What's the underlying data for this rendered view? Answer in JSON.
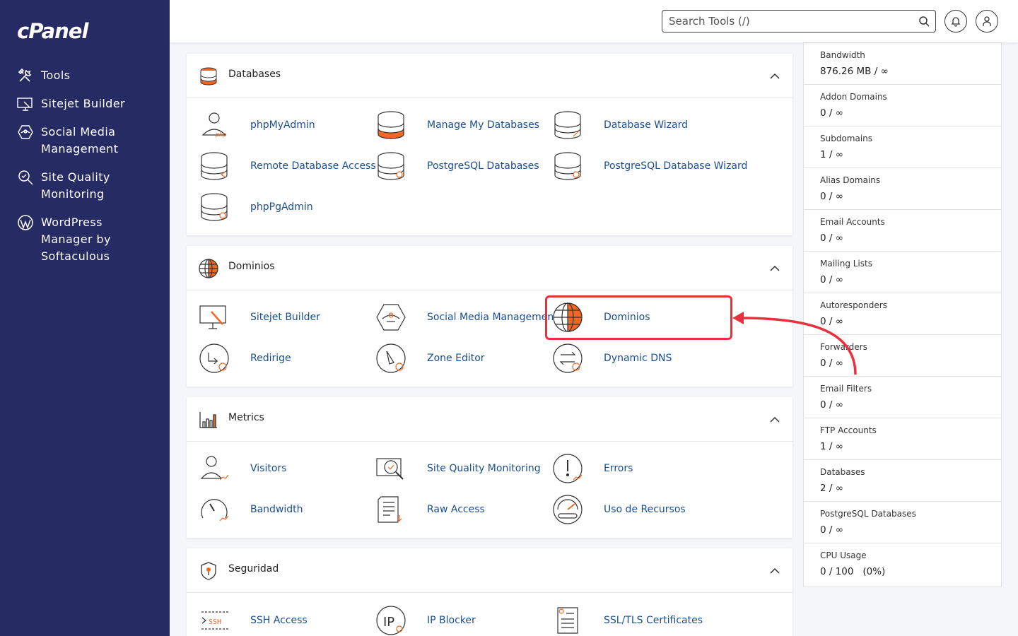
{
  "brand": {
    "logo": "cPanel"
  },
  "sidebar": {
    "items": [
      {
        "label": "Tools",
        "icon": "tools-icon"
      },
      {
        "label": "Sitejet Builder",
        "icon": "sitejet-icon"
      },
      {
        "label": "Social Media Management",
        "icon": "social-media-icon"
      },
      {
        "label": "Site Quality Monitoring",
        "icon": "site-quality-icon"
      },
      {
        "label": "WordPress Manager by Softaculous",
        "icon": "wordpress-icon"
      }
    ]
  },
  "header": {
    "search_placeholder": "Search Tools (/)",
    "search_icon": "search-icon",
    "notifications_icon": "bell-icon",
    "user_icon": "user-icon"
  },
  "sections": [
    {
      "title": "Databases",
      "icon": "database-icon",
      "tools": [
        {
          "label": "phpMyAdmin",
          "icon": "phpmyadmin-icon"
        },
        {
          "label": "Manage My Databases",
          "icon": "manage-databases-icon"
        },
        {
          "label": "Database Wizard",
          "icon": "database-wizard-icon"
        },
        {
          "label": "Remote Database Access",
          "icon": "remote-database-icon"
        },
        {
          "label": "PostgreSQL Databases",
          "icon": "postgresql-icon"
        },
        {
          "label": "PostgreSQL Database Wizard",
          "icon": "postgresql-wizard-icon"
        },
        {
          "label": "phpPgAdmin",
          "icon": "phppgadmin-icon"
        }
      ]
    },
    {
      "title": "Dominios",
      "icon": "globe-icon",
      "tools": [
        {
          "label": "Sitejet Builder",
          "icon": "sitejet-icon"
        },
        {
          "label": "Social Media Management",
          "icon": "social-media-icon"
        },
        {
          "label": "Dominios",
          "icon": "globe-icon"
        },
        {
          "label": "Redirige",
          "icon": "redirect-icon"
        },
        {
          "label": "Zone Editor",
          "icon": "zone-editor-icon"
        },
        {
          "label": "Dynamic DNS",
          "icon": "dynamic-dns-icon"
        }
      ]
    },
    {
      "title": "Metrics",
      "icon": "metrics-icon",
      "tools": [
        {
          "label": "Visitors",
          "icon": "visitors-icon"
        },
        {
          "label": "Site Quality Monitoring",
          "icon": "site-quality-icon"
        },
        {
          "label": "Errors",
          "icon": "errors-icon"
        },
        {
          "label": "Bandwidth",
          "icon": "bandwidth-icon"
        },
        {
          "label": "Raw Access",
          "icon": "raw-access-icon"
        },
        {
          "label": "Uso de Recursos",
          "icon": "resource-usage-icon"
        }
      ]
    },
    {
      "title": "Seguridad",
      "icon": "shield-icon",
      "tools": [
        {
          "label": "SSH Access",
          "icon": "ssh-icon"
        },
        {
          "label": "IP Blocker",
          "icon": "ip-blocker-icon"
        },
        {
          "label": "SSL/TLS Certificates",
          "icon": "ssl-icon"
        }
      ]
    }
  ],
  "stats": [
    {
      "label": "Bandwidth",
      "value": "876.26 MB / ∞"
    },
    {
      "label": "Addon Domains",
      "value": "0 / ∞"
    },
    {
      "label": "Subdomains",
      "value": "1 / ∞"
    },
    {
      "label": "Alias Domains",
      "value": "0 / ∞"
    },
    {
      "label": "Email Accounts",
      "value": "0 / ∞"
    },
    {
      "label": "Mailing Lists",
      "value": "0 / ∞"
    },
    {
      "label": "Autoresponders",
      "value": "0 / ∞"
    },
    {
      "label": "Forwarders",
      "value": "0 / ∞"
    },
    {
      "label": "Email Filters",
      "value": "0 / ∞"
    },
    {
      "label": "FTP Accounts",
      "value": "1 / ∞"
    },
    {
      "label": "Databases",
      "value": "2 / ∞"
    },
    {
      "label": "PostgreSQL Databases",
      "value": "0 / ∞"
    },
    {
      "label": "CPU Usage",
      "value": "0 / 100   (0%)"
    }
  ],
  "colors": {
    "sidebar": "#262b63",
    "link": "#1a4f8f",
    "accent": "#f26722",
    "annotation": "#e8313c"
  }
}
